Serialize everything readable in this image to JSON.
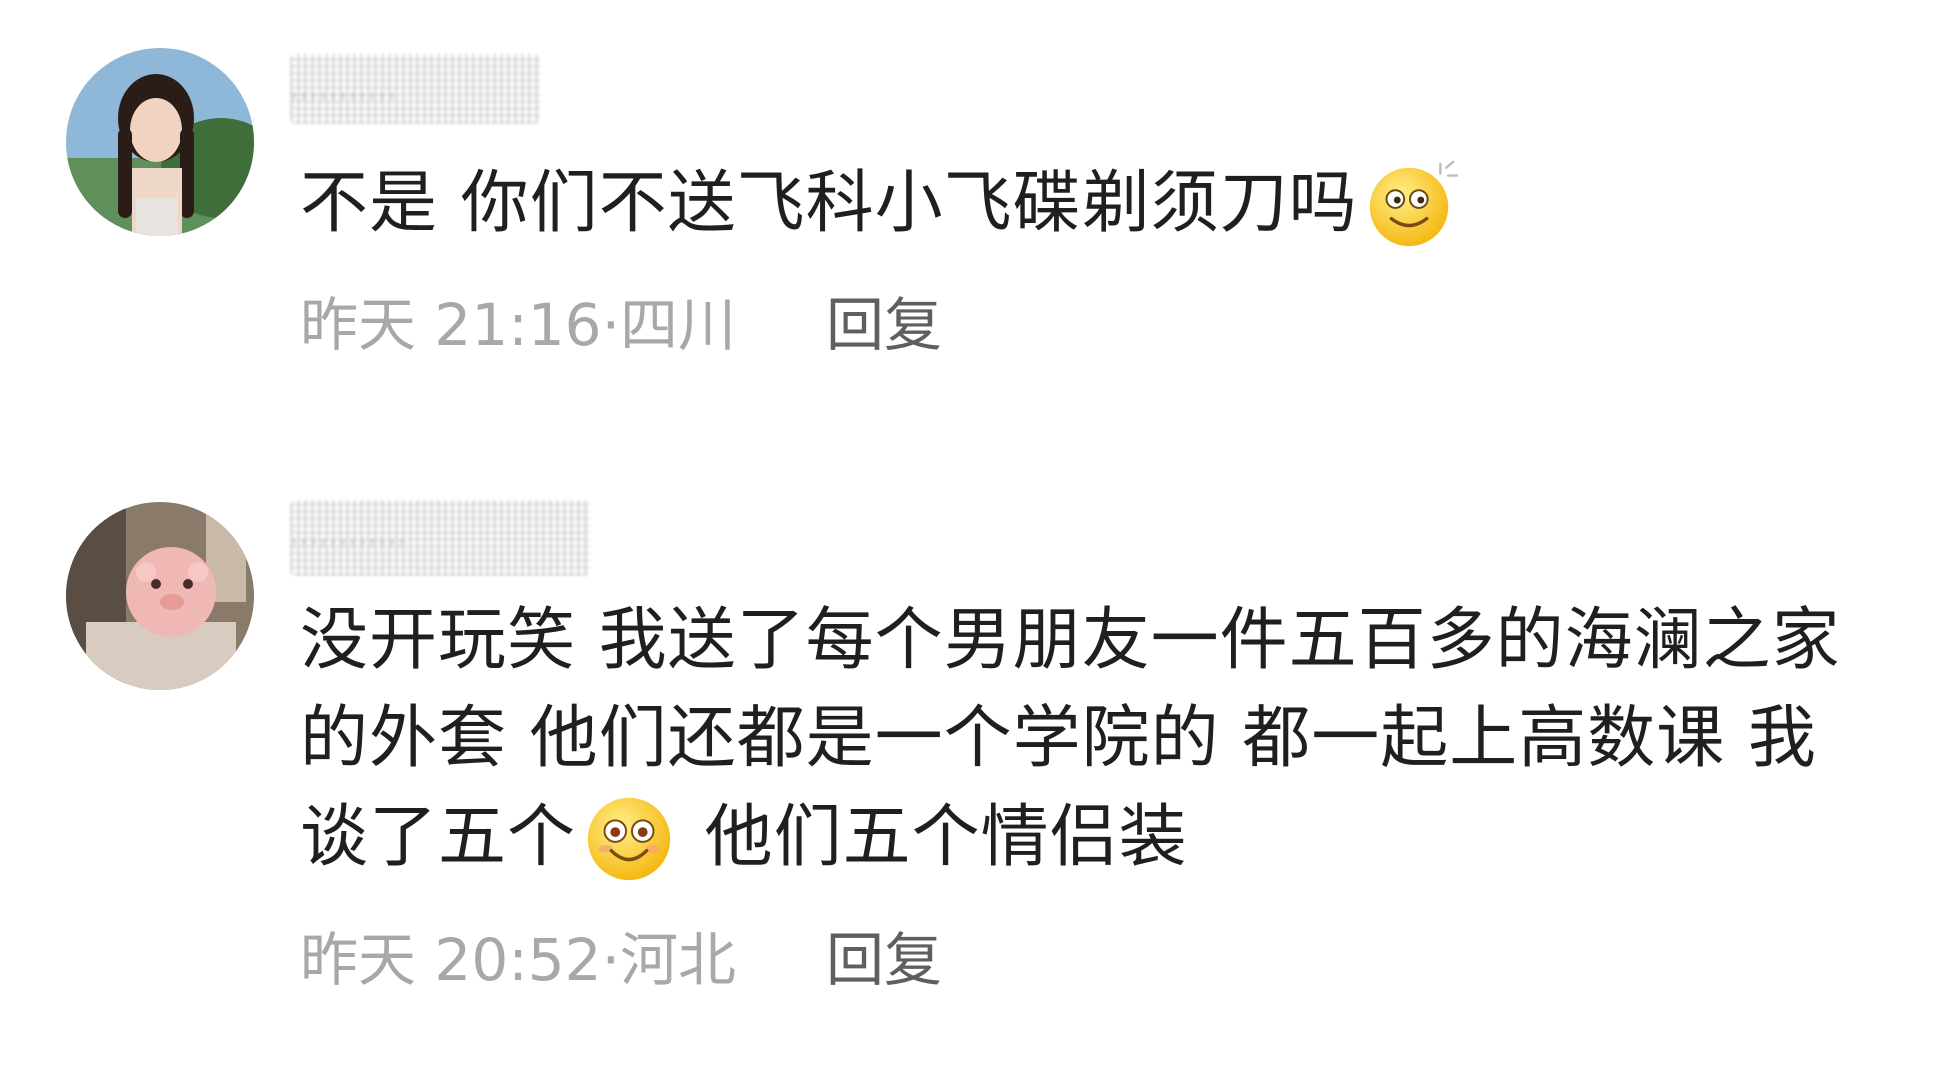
{
  "comments": [
    {
      "username": "ꓹꓹꓹꓹꓹꓹꓹꓹꓹꓹꓹ",
      "text_before_emoji": "不是 你们不送飞科小飞碟剃须刀吗",
      "emoji": "dizzy-smile-emoji",
      "text_after_emoji": "",
      "timestamp": "昨天 21:16",
      "location": "四川",
      "separator": "·",
      "reply_label": "回复"
    },
    {
      "username": "ꓹꓹꓹꓹꓹꓹꓹꓹꓹꓹꓹꓹ",
      "text_before_emoji": "没开玩笑 我送了每个男朋友一件五百多的海澜之家的外套 他们还都是一个学院的 都一起上高数课 我谈了五个",
      "emoji": "blushing-smile-emoji",
      "text_after_emoji": " 他们五个情侣装",
      "timestamp": "昨天 20:52",
      "location": "河北",
      "separator": "·",
      "reply_label": "回复"
    }
  ],
  "colors": {
    "text": "#1f1f1f",
    "meta": "#a8a8a8",
    "reply": "#5f5f5f",
    "background": "#ffffff"
  }
}
